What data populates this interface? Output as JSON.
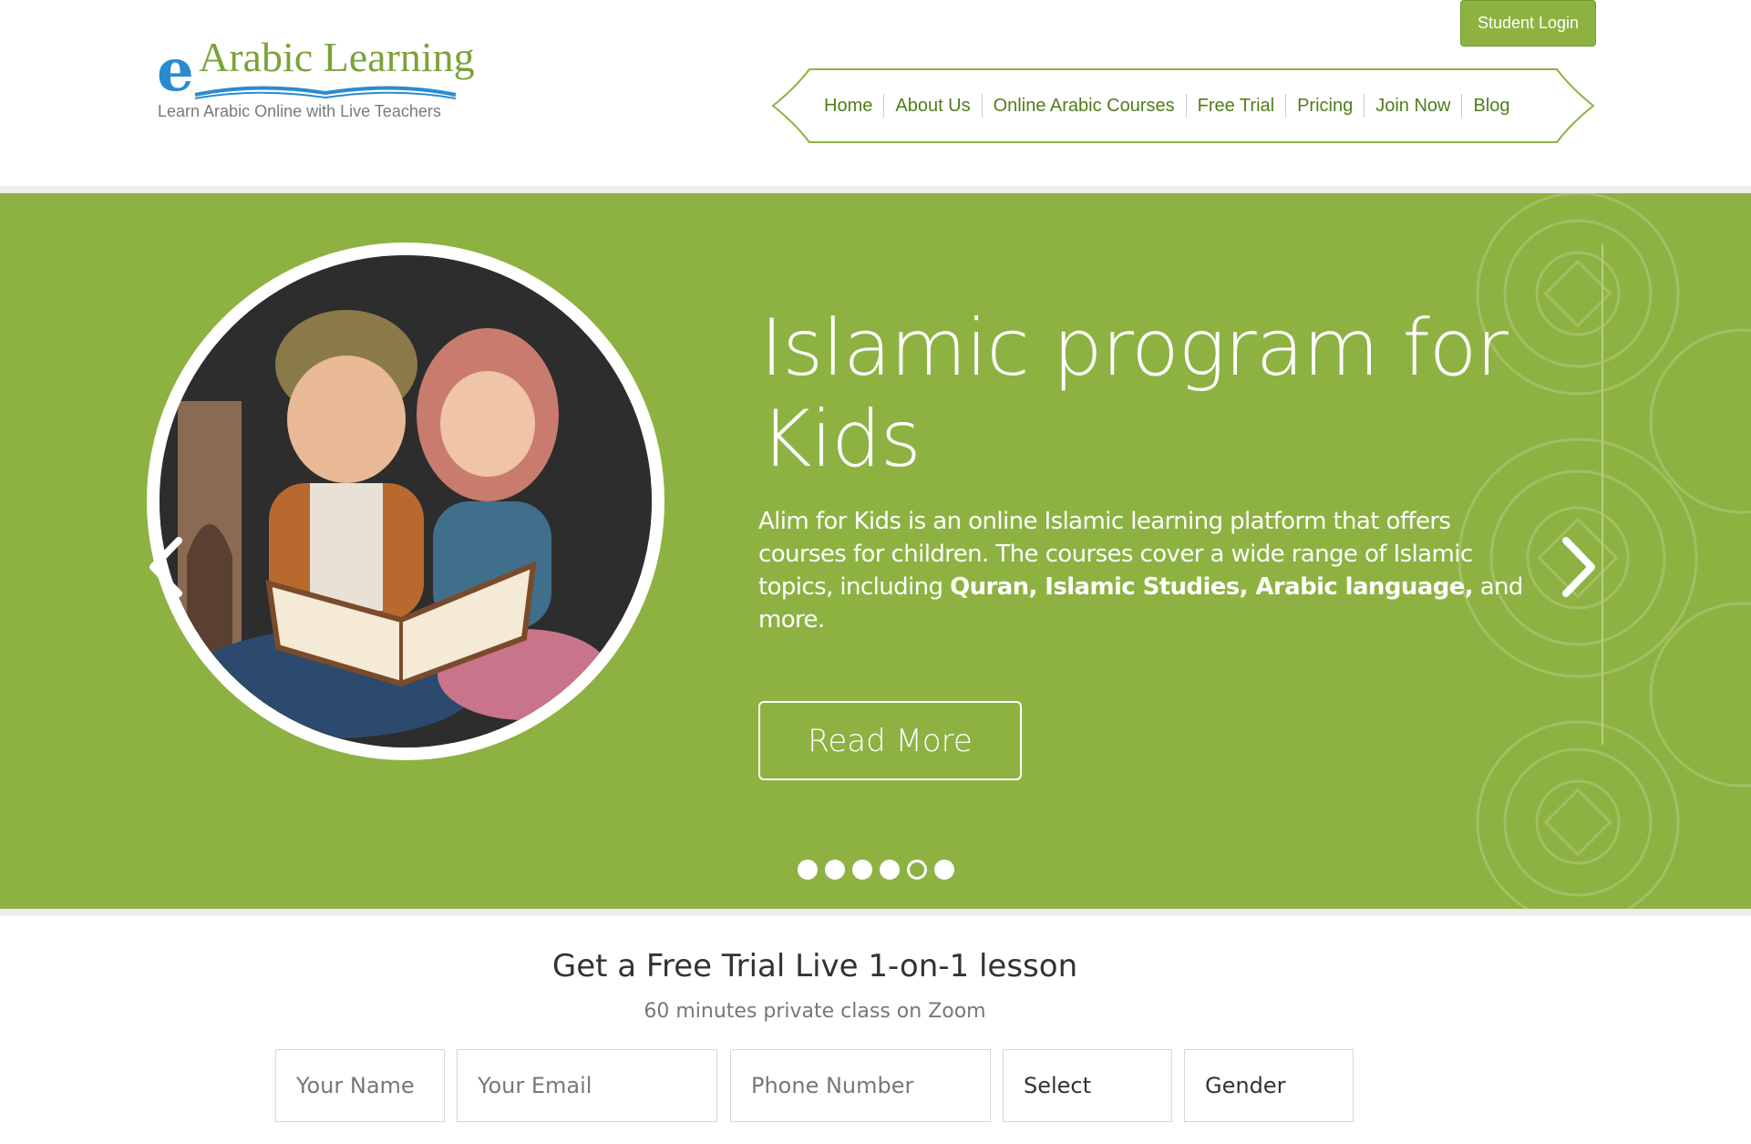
{
  "header": {
    "logo_letter": "e",
    "logo_name": "Arabic Learning",
    "logo_tagline": "Learn Arabic Online with Live Teachers",
    "student_login": "Student Login",
    "nav": [
      "Home",
      "About Us",
      "Online Arabic Courses",
      "Free Trial",
      "Pricing",
      "Join Now",
      "Blog"
    ]
  },
  "hero": {
    "title": "Islamic program for Kids",
    "desc_prefix": "Alim for Kids is an online Islamic learning platform that offers courses for children. The courses cover a wide range of Islamic topics, including ",
    "desc_bold": "Quran, Islamic Studies, Arabic language,",
    "desc_suffix": " and more.",
    "button": "Read More",
    "slide_count": 6,
    "active_slide": 5,
    "accent_color": "#8db242"
  },
  "trial": {
    "title": "Get a Free Trial Live 1-on-1 lesson",
    "subtitle": "60 minutes private class on Zoom",
    "fields": {
      "name": "Your Name",
      "email": "Your Email",
      "phone": "Phone Number",
      "select": "Select",
      "gender": "Gender"
    }
  }
}
